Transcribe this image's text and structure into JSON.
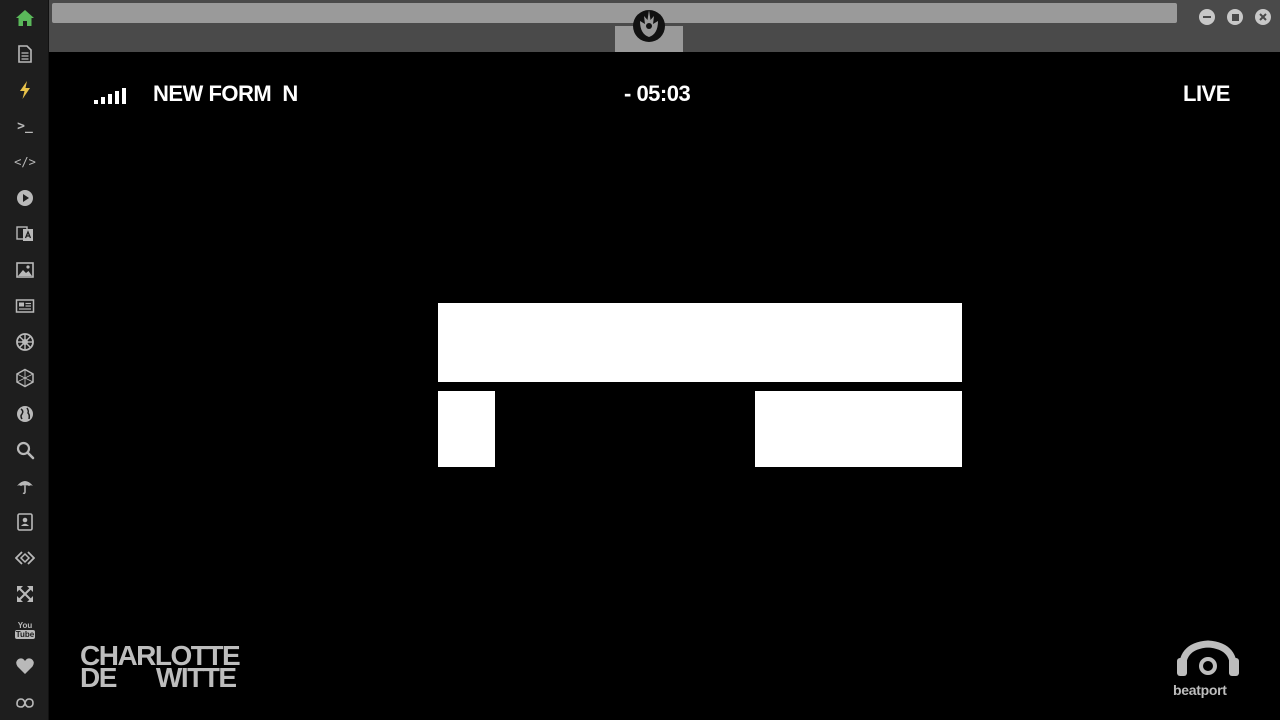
{
  "colors": {
    "sidebar_bg": "#1e1e1e",
    "icon_gray": "#b9b9b9",
    "home_green": "#5ab85a",
    "bolt_yellow": "#e8c24a",
    "titlebar": "#4a4a4a",
    "urlbar": "#9a9a9a"
  },
  "sidebar": {
    "items": [
      {
        "icon": "home-icon"
      },
      {
        "icon": "document-icon"
      },
      {
        "icon": "lightning-icon"
      },
      {
        "icon": "terminal-icon",
        "glyph": ">_"
      },
      {
        "icon": "code-icon",
        "glyph": "</>"
      },
      {
        "icon": "play-circle-icon"
      },
      {
        "icon": "translate-icon"
      },
      {
        "icon": "image-icon"
      },
      {
        "icon": "newspaper-icon"
      },
      {
        "icon": "empire-icon"
      },
      {
        "icon": "hexagon-icon"
      },
      {
        "icon": "globe-icon"
      },
      {
        "icon": "search-icon"
      },
      {
        "icon": "umbrella-icon"
      },
      {
        "icon": "contacts-icon"
      },
      {
        "icon": "code-diamond-icon"
      },
      {
        "icon": "expand-arrows-icon"
      },
      {
        "icon": "youtube-icon",
        "glyph_top": "You",
        "glyph_bottom": "Tube"
      },
      {
        "icon": "heart-icon"
      },
      {
        "icon": "infinity-cloud-icon"
      }
    ]
  },
  "titlebar": {
    "tab_icon": "rebel-alliance-icon",
    "window_controls": [
      "minimize-icon",
      "maximize-icon",
      "close-icon"
    ]
  },
  "stream": {
    "signal_icon": "signal-bars-icon",
    "ticker_text": "NEW FORM  N",
    "timer": "- 05:03",
    "live_label": "LIVE",
    "artist_line1": "CHARLOTTE",
    "artist_line2a": "DE",
    "artist_line2b": "WITTE",
    "brand_icon": "beatport-icon",
    "brand_text": "beatport"
  }
}
